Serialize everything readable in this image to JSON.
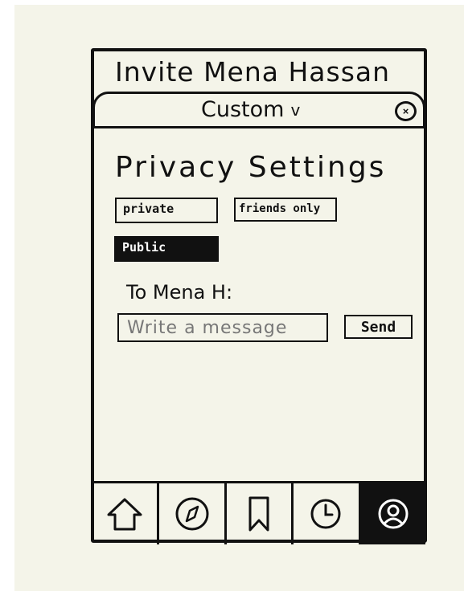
{
  "header": {
    "title": "Invite Mena Hassan"
  },
  "audience": {
    "selected": "Custom",
    "arrow": "v",
    "close_glyph": "×"
  },
  "privacy": {
    "title": "Privacy Settings",
    "options": [
      {
        "label": "private",
        "selected": false
      },
      {
        "label": "friends only",
        "selected": false
      },
      {
        "label": "Public",
        "selected": true
      }
    ]
  },
  "message": {
    "recipient_label": "To Mena H:",
    "placeholder": "Write a message",
    "send_label": "Send"
  },
  "nav": {
    "items": [
      {
        "icon": "home-icon",
        "active": false
      },
      {
        "icon": "compass-icon",
        "active": false
      },
      {
        "icon": "bookmark-icon",
        "active": false
      },
      {
        "icon": "clock-icon",
        "active": false
      },
      {
        "icon": "profile-icon",
        "active": true
      }
    ]
  },
  "colors": {
    "ink": "#111111",
    "paper": "#f4f4e9",
    "active": "#111111"
  }
}
